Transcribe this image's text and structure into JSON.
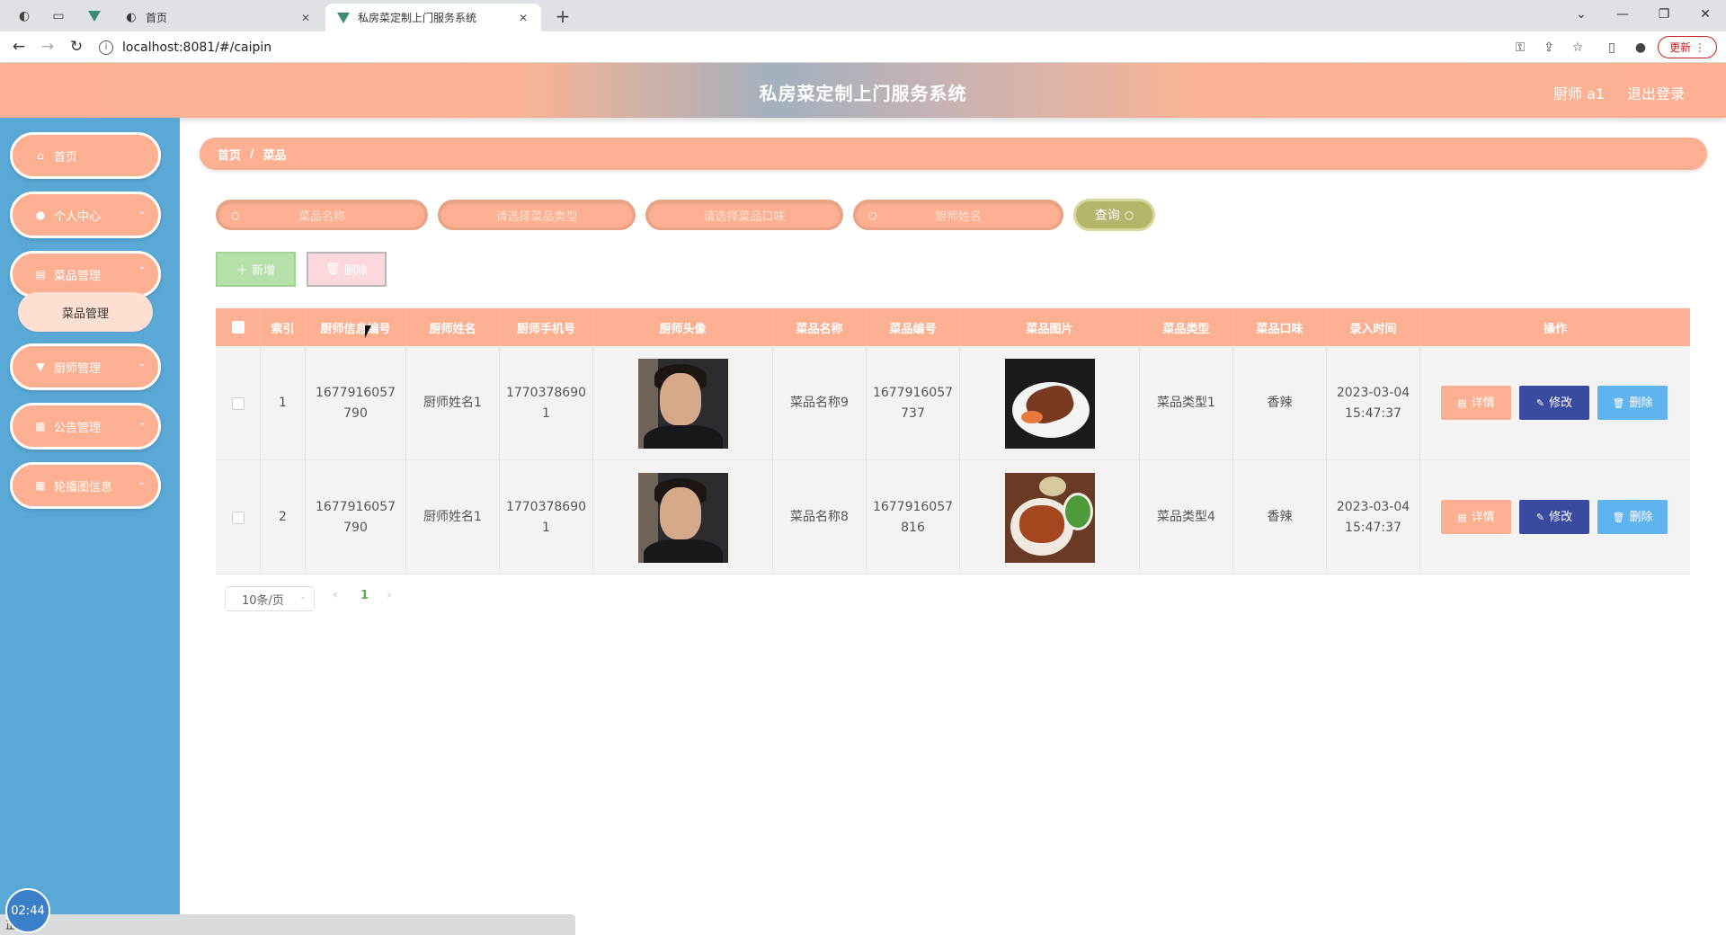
{
  "browser": {
    "tabs": [
      {
        "title": "首页",
        "icon": "globe-icon"
      },
      {
        "title": "私房菜定制上门服务系统",
        "icon": "vue-logo-icon"
      }
    ],
    "address": "localhost:8081/#/caipin",
    "update_label": "更新"
  },
  "header": {
    "title": "私房菜定制上门服务系统",
    "user": "厨师 a1",
    "logout": "退出登录",
    "accent_color": "#fcb091"
  },
  "sidebar": {
    "items": [
      {
        "label": "首页",
        "icon": "home-icon"
      },
      {
        "label": "个人中心",
        "icon": "user-icon"
      },
      {
        "label": "菜品管理",
        "icon": "clipboard-icon"
      },
      {
        "label": "厨师管理",
        "icon": "chef-icon"
      },
      {
        "label": "公告管理",
        "icon": "grid-icon"
      },
      {
        "label": "轮播图信息",
        "icon": "grid-icon"
      }
    ],
    "submenu": {
      "label": "菜品管理"
    },
    "bg_color": "#5aa8d5"
  },
  "breadcrumb": {
    "home": "首页",
    "separator": "/",
    "current": "菜品"
  },
  "search": {
    "inputs": [
      {
        "placeholder": "菜品名称"
      },
      {
        "placeholder": "请选择菜品类型"
      },
      {
        "placeholder": "请选择菜品口味"
      },
      {
        "placeholder": "厨师姓名"
      }
    ],
    "query_label": "查询"
  },
  "actions": {
    "add_label": "新增",
    "delete_label": "删除"
  },
  "table": {
    "columns": [
      "索引",
      "厨师信息编号",
      "厨师姓名",
      "厨师手机号",
      "厨师头像",
      "菜品名称",
      "菜品编号",
      "菜品图片",
      "菜品类型",
      "菜品口味",
      "录入时间",
      "操作"
    ],
    "rows": [
      {
        "index": "1",
        "chef_id_a": "1677916057",
        "chef_id_b": "790",
        "chef_name": "厨师姓名1",
        "phone_a": "1770378690",
        "phone_b": "1",
        "dish_name": "菜品名称9",
        "dish_id_a": "1677916057",
        "dish_id_b": "737",
        "dish_type": "菜品类型1",
        "flavor": "香辣",
        "date": "2023-03-04",
        "time": "15:47:37"
      },
      {
        "index": "2",
        "chef_id_a": "1677916057",
        "chef_id_b": "790",
        "chef_name": "厨师姓名1",
        "phone_a": "1770378690",
        "phone_b": "1",
        "dish_name": "菜品名称8",
        "dish_id_a": "1677916057",
        "dish_id_b": "816",
        "dish_type": "菜品类型4",
        "flavor": "香辣",
        "date": "2023-03-04",
        "time": "15:47:37"
      }
    ],
    "row_actions": {
      "detail": "详情",
      "edit": "修改",
      "delete": "删除"
    }
  },
  "pagination": {
    "page_size": "10条/页",
    "current_page": "1"
  },
  "overlay": {
    "clock": "02:44",
    "status": "正在..."
  }
}
